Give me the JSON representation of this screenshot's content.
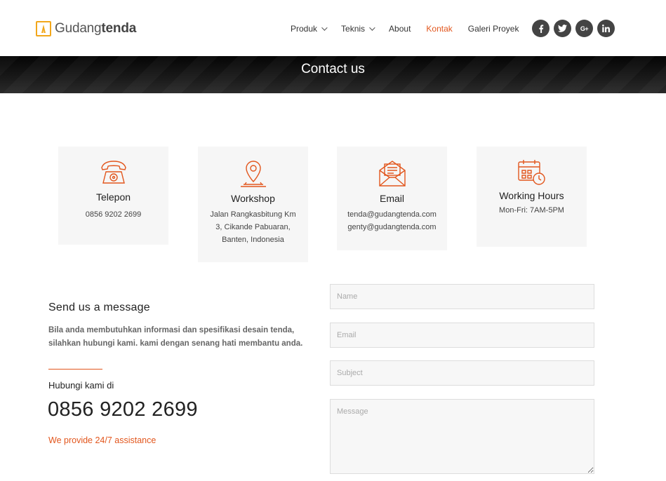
{
  "brand": {
    "name_regular": "Gudang",
    "name_bold": "tenda",
    "accent": "#e2561d",
    "logo_color": "#f2a71b"
  },
  "nav": {
    "items": [
      {
        "label": "Produk",
        "dropdown": true
      },
      {
        "label": "Teknis",
        "dropdown": true
      },
      {
        "label": "About",
        "dropdown": false
      },
      {
        "label": "Kontak",
        "dropdown": false,
        "active": true
      },
      {
        "label": "Galeri Proyek",
        "dropdown": false
      }
    ]
  },
  "socials": [
    {
      "name": "facebook-icon",
      "glyph": "f"
    },
    {
      "name": "twitter-icon",
      "glyph": "t"
    },
    {
      "name": "google-plus-icon",
      "glyph": "G+"
    },
    {
      "name": "linkedin-icon",
      "glyph": "in"
    }
  ],
  "banner": {
    "title": "Contact us"
  },
  "cards": {
    "phone": {
      "title": "Telepon",
      "line1": "0856 9202 2699"
    },
    "workshop": {
      "title": "Workshop",
      "line1": "Jalan Rangkasbitung Km",
      "line2": "3, Cikande Pabuaran,",
      "line3": "Banten, Indonesia"
    },
    "email": {
      "title": "Email",
      "line1": "tenda@gudangtenda.com",
      "line2": "genty@gudangtenda.com"
    },
    "hours": {
      "title": "Working Hours",
      "line1": "Mon-Fri: 7AM-5PM"
    }
  },
  "message": {
    "title": "Send us a message",
    "description": "Bila anda membutuhkan informasi dan spesifikasi desain tenda, silahkan hubungi kami. kami dengan senang hati membantu anda.",
    "call_label": "Hubungi kami di",
    "call_number": "0856 9202 2699",
    "assistance": "We provide 24/7 assistance"
  },
  "form": {
    "name_placeholder": "Name",
    "email_placeholder": "Email",
    "subject_placeholder": "Subject",
    "message_placeholder": "Message"
  }
}
